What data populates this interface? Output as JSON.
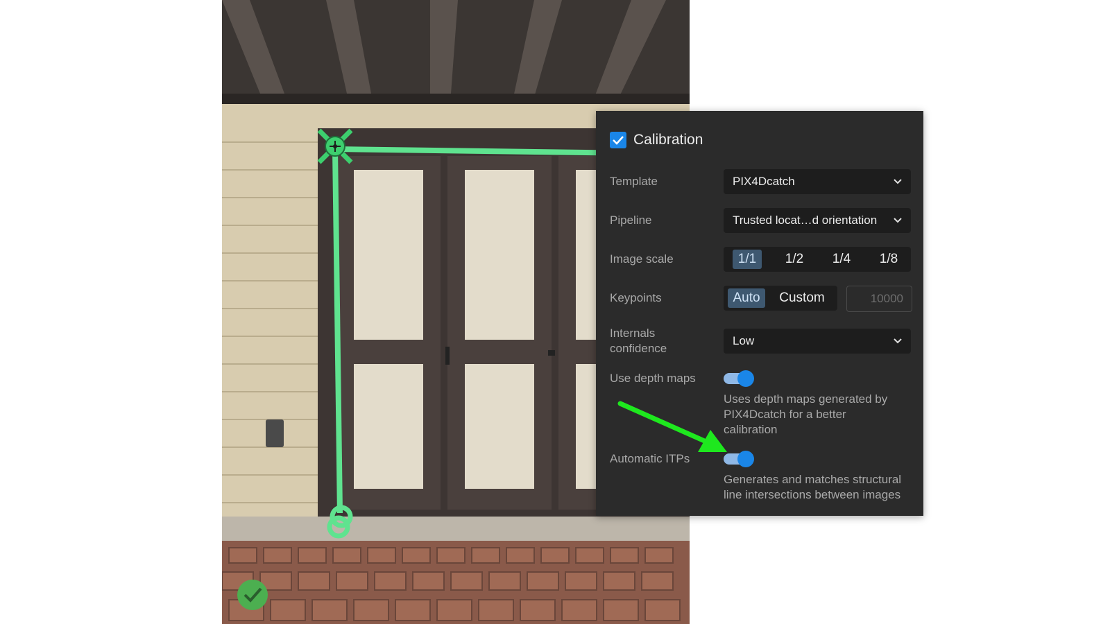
{
  "panel": {
    "title": "Calibration",
    "checked": true,
    "template": {
      "label": "Template",
      "value": "PIX4Dcatch"
    },
    "pipeline": {
      "label": "Pipeline",
      "value": "Trusted locat…d orientation"
    },
    "image_scale": {
      "label": "Image scale",
      "options": [
        "1/1",
        "1/2",
        "1/4",
        "1/8"
      ],
      "selected": "1/1"
    },
    "keypoints": {
      "label": "Keypoints",
      "options": [
        "Auto",
        "Custom"
      ],
      "selected": "Auto",
      "custom_placeholder": "10000"
    },
    "internals_confidence": {
      "label_line1": "Internals",
      "label_line2": "confidence",
      "value": "Low"
    },
    "use_depth_maps": {
      "label": "Use depth maps",
      "enabled": true,
      "desc_lines": [
        "Uses depth maps generated by",
        "PIX4Dcatch for a better",
        "calibration"
      ]
    },
    "automatic_itps": {
      "label": "Automatic ITPs",
      "enabled": true,
      "desc_lines": [
        "Generates and matches structural",
        "line intersections between images"
      ]
    }
  },
  "colors": {
    "panel_bg": "#2b2b2b",
    "accent": "#1a86e8",
    "toggle_track": "#8fb8e6",
    "selected_segment": "#3e5870",
    "overlay_line": "#5fe38f",
    "arrow": "#1ee81e",
    "check_badge": "#4caf50"
  },
  "icons": {
    "checkbox": "check-icon",
    "dropdown": "chevron-down-icon",
    "target_marker": "crosshair-target-icon",
    "annotation_arrow": "arrow-icon",
    "status_badge": "check-circle-icon"
  }
}
